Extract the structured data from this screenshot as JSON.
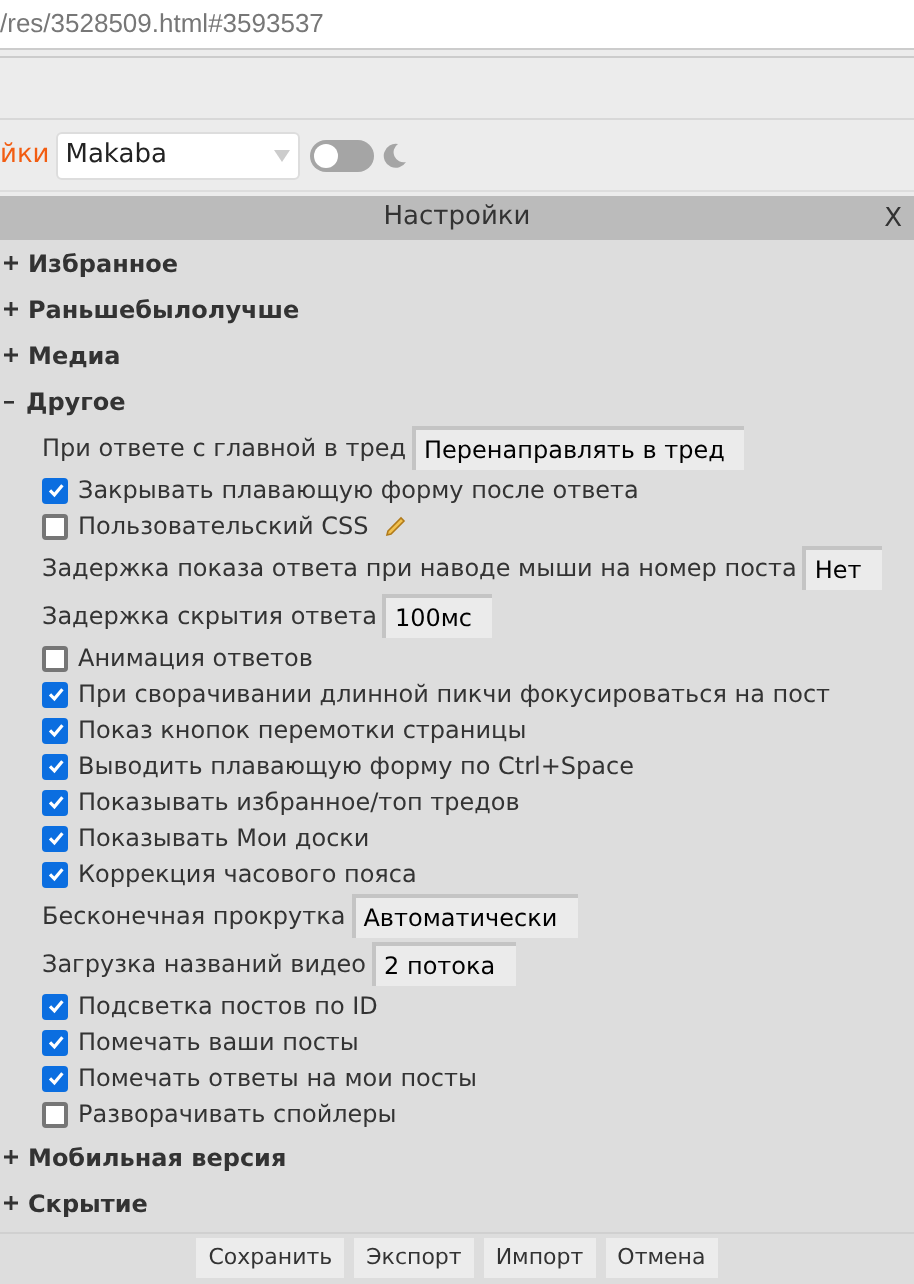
{
  "address_bar": {
    "url": "/res/3528509.html#3593537"
  },
  "style_bar": {
    "label": "йки",
    "style_select": "Makaba",
    "dark_mode": {
      "on": false
    }
  },
  "settings": {
    "title": "Настройки",
    "close": "X",
    "sections": [
      {
        "title": "Избранное",
        "expanded": false
      },
      {
        "title": "Раньшебылолучше",
        "expanded": false
      },
      {
        "title": "Медиа",
        "expanded": false
      },
      {
        "title": "Другое",
        "expanded": true,
        "items": [
          {
            "kind": "select",
            "label": "При ответе с главной в тред",
            "value": "Перенаправлять в тред"
          },
          {
            "kind": "checkbox",
            "label": "Закрывать плавающую форму после ответа",
            "checked": true
          },
          {
            "kind": "checkbox",
            "label": "Пользовательский CSS",
            "checked": false,
            "editable": true
          },
          {
            "kind": "select",
            "label": "Задержка показа ответа при наводе мыши на номер поста",
            "value": "Нет"
          },
          {
            "kind": "select",
            "label": "Задержка скрытия ответа",
            "value": "100мс"
          },
          {
            "kind": "checkbox",
            "label": "Анимация ответов",
            "checked": false
          },
          {
            "kind": "checkbox",
            "label": "При сворачивании длинной пикчи фокусироваться на пост",
            "checked": true
          },
          {
            "kind": "checkbox",
            "label": "Показ кнопок перемотки страницы",
            "checked": true
          },
          {
            "kind": "checkbox",
            "label": "Выводить плавающую форму по Ctrl+Space",
            "checked": true
          },
          {
            "kind": "checkbox",
            "label": "Показывать избранное/топ тредов",
            "checked": true
          },
          {
            "kind": "checkbox",
            "label": "Показывать Мои доски",
            "checked": true
          },
          {
            "kind": "checkbox",
            "label": "Коррекция часового пояса",
            "checked": true
          },
          {
            "kind": "select",
            "label": "Бесконечная прокрутка",
            "value": "Автоматически"
          },
          {
            "kind": "select",
            "label": "Загрузка названий видео",
            "value": "2 потока"
          },
          {
            "kind": "checkbox",
            "label": "Подсветка постов по ID",
            "checked": true
          },
          {
            "kind": "checkbox",
            "label": "Помечать ваши посты",
            "checked": true
          },
          {
            "kind": "checkbox",
            "label": "Помечать ответы на мои посты",
            "checked": true
          },
          {
            "kind": "checkbox",
            "label": "Разворачивать спойлеры",
            "checked": false
          }
        ]
      },
      {
        "title": "Мобильная версия",
        "expanded": false
      },
      {
        "title": "Скрытие",
        "expanded": false
      }
    ],
    "buttons": [
      "Сохранить",
      "Экспорт",
      "Импорт",
      "Отмена"
    ]
  }
}
